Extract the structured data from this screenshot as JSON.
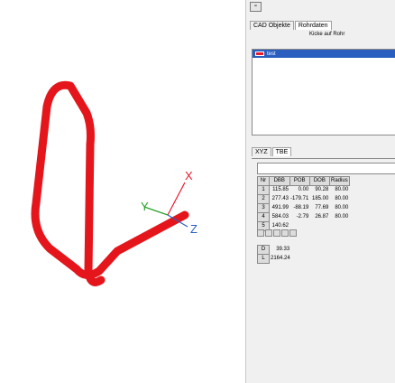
{
  "viewport": {
    "axes": {
      "x_label": "X",
      "y_label": "Y",
      "z_label": "Z"
    },
    "colors": {
      "pipe": "#e4161c",
      "axis_x": "#e8192c",
      "axis_y": "#2aa02a",
      "axis_z": "#2a5fbf"
    }
  },
  "panel": {
    "minimize_label": "-",
    "tabs_top": [
      "CAD Objekte",
      "Rohrdaten"
    ],
    "kicke_label": "Kicke auf Rohr",
    "list": {
      "items": [
        {
          "label": "test",
          "color": "#e8192c"
        }
      ]
    },
    "tabs_mid": [
      "XYZ",
      "TBE"
    ],
    "table": {
      "columns": [
        "Nr",
        "DBB",
        "POB",
        "DOB",
        "Radius"
      ],
      "rows": [
        [
          "1",
          "115.85",
          "0.00",
          "90.28",
          "80.00"
        ],
        [
          "2",
          "277.43",
          "-179.71",
          "185.00",
          "80.00"
        ],
        [
          "3",
          "491.99",
          "-88.19",
          "77.69",
          "80.00"
        ],
        [
          "4",
          "584.03",
          "-2.79",
          "26.87",
          "80.00"
        ],
        [
          "5",
          "140.62",
          "",
          "",
          ""
        ]
      ]
    },
    "summary": [
      {
        "key": "D",
        "value": "39.33"
      },
      {
        "key": "L",
        "value": "2164.24"
      }
    ]
  }
}
